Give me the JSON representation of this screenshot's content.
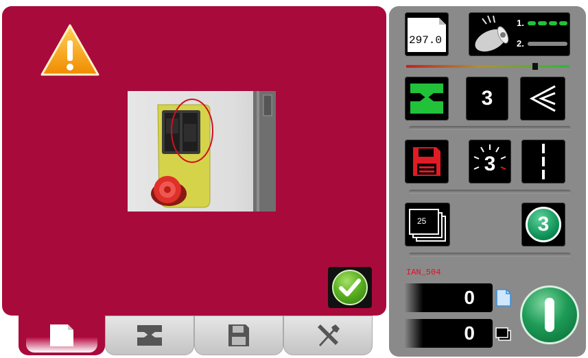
{
  "alert": {
    "confirm_label": ""
  },
  "tabs": [
    {
      "name": "document",
      "icon": "document-icon",
      "active": true
    },
    {
      "name": "press",
      "icon": "press-icon",
      "active": false
    },
    {
      "name": "save",
      "icon": "floppy-disk-icon",
      "active": false
    },
    {
      "name": "tools",
      "icon": "wrench-screwdriver-icon",
      "active": false
    }
  ],
  "control": {
    "dimension_value": "297.0",
    "jaw_count": "3",
    "blink_count": "3",
    "sheets_count": "25",
    "step_badge": "3",
    "program_name": "IAN_504",
    "counter_pieces": "0",
    "counter_sheets": "0",
    "speed_level": 0.8,
    "level_1_label": "1.",
    "level_2_label": "2."
  },
  "colors": {
    "alert_bg": "#a90a3c",
    "panel_bg": "#8a8a8a",
    "accent_green": "#22c13a",
    "program_red": "#e0102a"
  }
}
